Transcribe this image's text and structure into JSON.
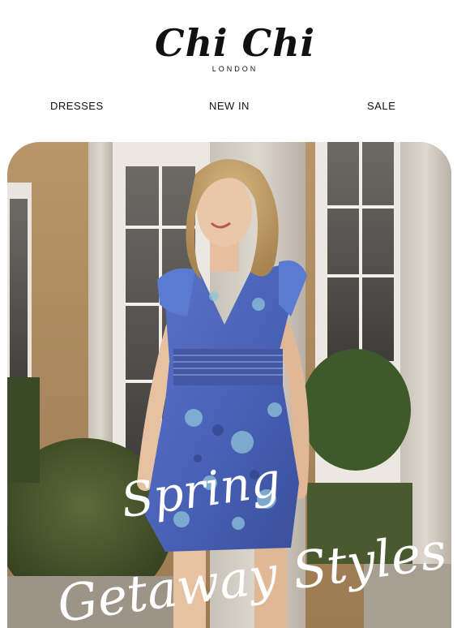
{
  "brand": {
    "name": "Chi Chi",
    "sub": "LONDON"
  },
  "nav": {
    "items": [
      "DRESSES",
      "NEW IN",
      "SALE"
    ]
  },
  "hero": {
    "line1": "Spring",
    "line2": "Getaway Styles",
    "dress_color": "#4a63b8",
    "accent": "#8fc3d9"
  }
}
